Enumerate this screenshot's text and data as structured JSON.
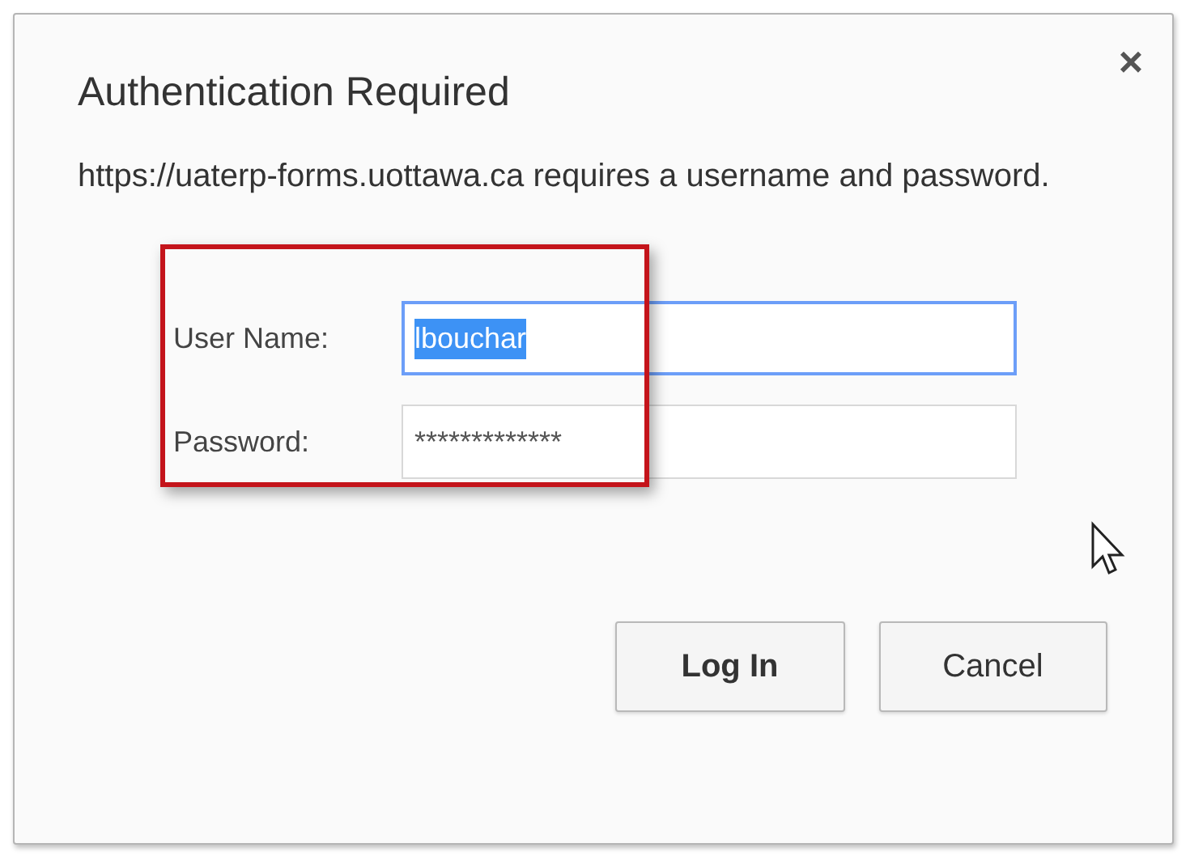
{
  "dialog": {
    "title": "Authentication Required",
    "close": "×",
    "message": "https://uaterp-forms.uottawa.ca requires a username and password.",
    "fields": [
      {
        "label": "User Name:",
        "value": "lbouchar",
        "focused": true,
        "value_selected": true
      },
      {
        "label": "Password:",
        "value": "*************",
        "focused": false,
        "value_selected": false
      }
    ],
    "highlight": true,
    "buttons": [
      {
        "label": "Log In",
        "default": true
      },
      {
        "label": "Cancel",
        "default": false
      }
    ]
  }
}
